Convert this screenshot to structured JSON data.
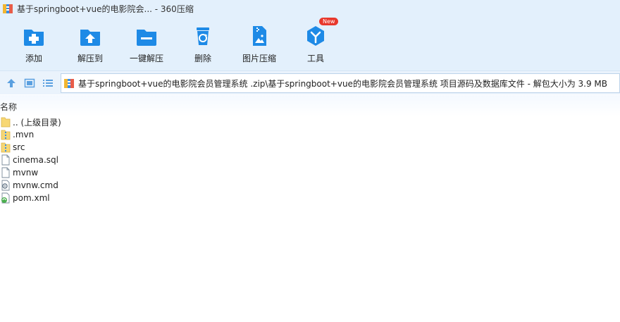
{
  "window": {
    "title": "基于springboot+vue的电影院会... - 360压缩"
  },
  "toolbar": {
    "items": [
      {
        "label": "添加",
        "icon": "add-icon"
      },
      {
        "label": "解压到",
        "icon": "extract-to-icon"
      },
      {
        "label": "一键解压",
        "icon": "one-click-extract-icon"
      },
      {
        "label": "删除",
        "icon": "delete-icon"
      },
      {
        "label": "图片压缩",
        "icon": "image-compress-icon"
      },
      {
        "label": "工具",
        "icon": "tools-icon",
        "badge": "New"
      }
    ]
  },
  "navbar": {
    "path": "基于springboot+vue的电影院会员管理系统 .zip\\基于springboot+vue的电影院会员管理系统 项目源码及数据库文件 - 解包大小为 3.9 MB"
  },
  "columns": {
    "name": "名称"
  },
  "files": [
    {
      "name": ".. (上级目录)",
      "type": "folder"
    },
    {
      "name": ".mvn",
      "type": "folder-zip"
    },
    {
      "name": "src",
      "type": "folder-zip"
    },
    {
      "name": "cinema.sql",
      "type": "file"
    },
    {
      "name": "mvnw",
      "type": "file"
    },
    {
      "name": "mvnw.cmd",
      "type": "cmd-file"
    },
    {
      "name": "pom.xml",
      "type": "xml-file"
    }
  ],
  "colors": {
    "chrome": "#e3f0fc",
    "icon_blue": "#1e8ae6",
    "badge_red": "#e8382c",
    "folder_yellow": "#f7d774"
  }
}
